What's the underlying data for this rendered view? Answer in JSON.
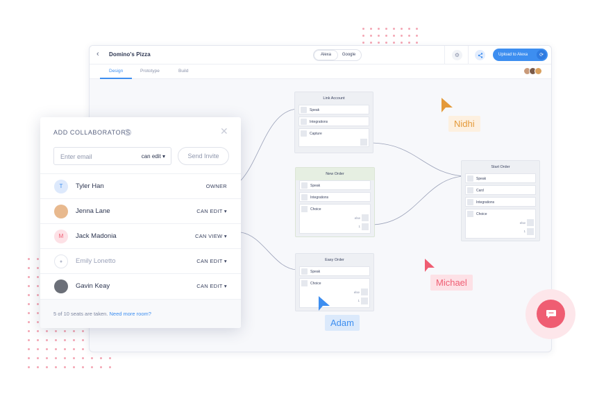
{
  "app": {
    "project_title": "Domino's Pizza",
    "platforms": [
      "Alexa",
      "Google"
    ],
    "upload_label": "Upload to Alexa",
    "tabs": [
      "Design",
      "Prototype",
      "Build"
    ],
    "accent": "#3d8ef0"
  },
  "canvas": {
    "link_account": {
      "title": "Link Account",
      "rows": [
        "Speak",
        "Integrations",
        "Capture"
      ]
    },
    "new_order": {
      "title": "New Order",
      "rows": [
        "Speak",
        "Integrations"
      ],
      "choice": "Choice",
      "options": [
        "else",
        "1"
      ]
    },
    "easy_order": {
      "title": "Easy Order",
      "rows": [
        "Speak"
      ],
      "choice": "Choice",
      "options": [
        "else",
        "1"
      ]
    },
    "start_order": {
      "title": "Start Order",
      "rows": [
        "Speak",
        "Card",
        "Integrations"
      ],
      "choice": "Choice",
      "options": [
        "else",
        "1"
      ]
    },
    "cursors": [
      {
        "name": "Nidhi",
        "color": "#e49a3a",
        "bg": "#fdf0e0"
      },
      {
        "name": "Michael",
        "color": "#ef5d72",
        "bg": "#fde1e6"
      },
      {
        "name": "Adam",
        "color": "#3d8ef0",
        "bg": "#dbe9fb"
      }
    ]
  },
  "collab": {
    "title": "ADD COLLABORATORS",
    "info_icon": "i",
    "email_placeholder": "Enter email",
    "permission": "can edit",
    "send_label": "Send Invite",
    "members": [
      {
        "initial": "T",
        "name": "Tyler Han",
        "role": "OWNER"
      },
      {
        "initial": "",
        "name": "Jenna Lane",
        "role": "CAN EDIT"
      },
      {
        "initial": "M",
        "name": "Jack Madonia",
        "role": "CAN VIEW"
      },
      {
        "initial": "",
        "name": "Emily Lonetto",
        "role": "CAN EDIT"
      },
      {
        "initial": "",
        "name": "Gavin Keay",
        "role": "CAN EDIT"
      }
    ],
    "seats_used": "5",
    "seats_text": " of 10 seats are taken.",
    "more_link": "Need more room?"
  }
}
